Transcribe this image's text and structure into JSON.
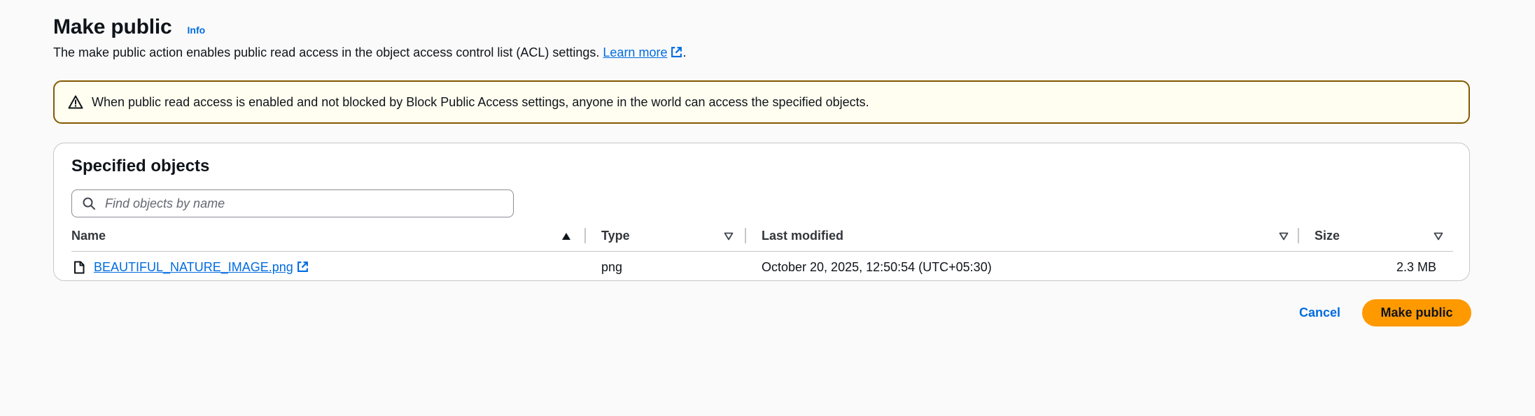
{
  "header": {
    "title": "Make public",
    "info_label": "Info",
    "description_text": "The make public action enables public read access in the object access control list (ACL) settings.",
    "learn_more_label": "Learn more",
    "description_suffix": "."
  },
  "alert": {
    "type": "warning",
    "text": "When public read access is enabled and not blocked by Block Public Access settings, anyone in the world can access the specified objects.",
    "icon": "warning-triangle-icon"
  },
  "objects_panel": {
    "title": "Specified objects",
    "search": {
      "value": "",
      "placeholder": "Find objects by name",
      "icon": "search-icon"
    },
    "columns": [
      {
        "label": "Name",
        "sort": "ascending"
      },
      {
        "label": "Type",
        "sort": "sortable"
      },
      {
        "label": "Last modified",
        "sort": "sortable"
      },
      {
        "label": "Size",
        "sort": "sortable"
      }
    ],
    "rows": [
      {
        "name": "BEAUTIFUL_NATURE_IMAGE.png",
        "type": "png",
        "last_modified": "October 20, 2025, 12:50:54 (UTC+05:30)",
        "size": "2.3 MB",
        "icon": "file-icon"
      }
    ]
  },
  "actions": {
    "cancel_label": "Cancel",
    "submit_label": "Make public"
  },
  "colors": {
    "link": "#006ce0",
    "primary_button": "#ff9900",
    "alert_border": "#855900",
    "alert_background": "#fffef0"
  }
}
